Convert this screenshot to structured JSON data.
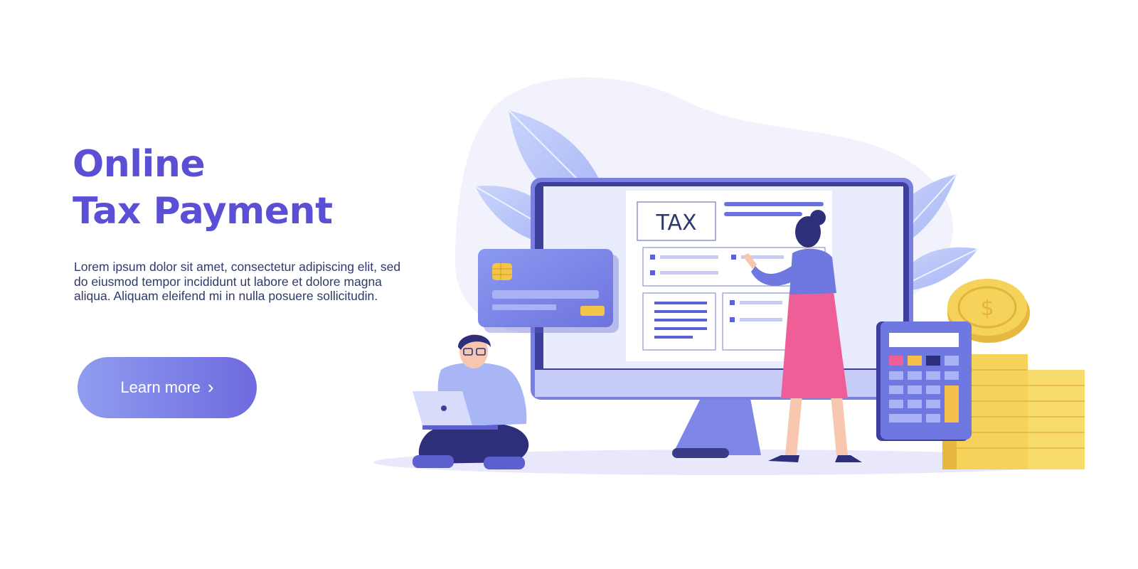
{
  "hero": {
    "title_line1": "Online",
    "title_line2": "Tax Payment",
    "description": "Lorem ipsum dolor sit amet, consectetur adipiscing elit, sed do eiusmod tempor incididunt ut labore et dolore magna aliqua. Aliquam eleifend mi in nulla posuere sollicitudin.",
    "cta_label": "Learn more",
    "cta_icon": "chevron-right-icon"
  },
  "illustration": {
    "form_heading": "TAX",
    "coin_symbol": "$"
  },
  "colors": {
    "brand_purple": "#5b4fd6",
    "accent_blue": "#7e86e6",
    "pink": "#ee5f98",
    "gold": "#f5d35a",
    "text_dark": "#2e3a6b"
  }
}
